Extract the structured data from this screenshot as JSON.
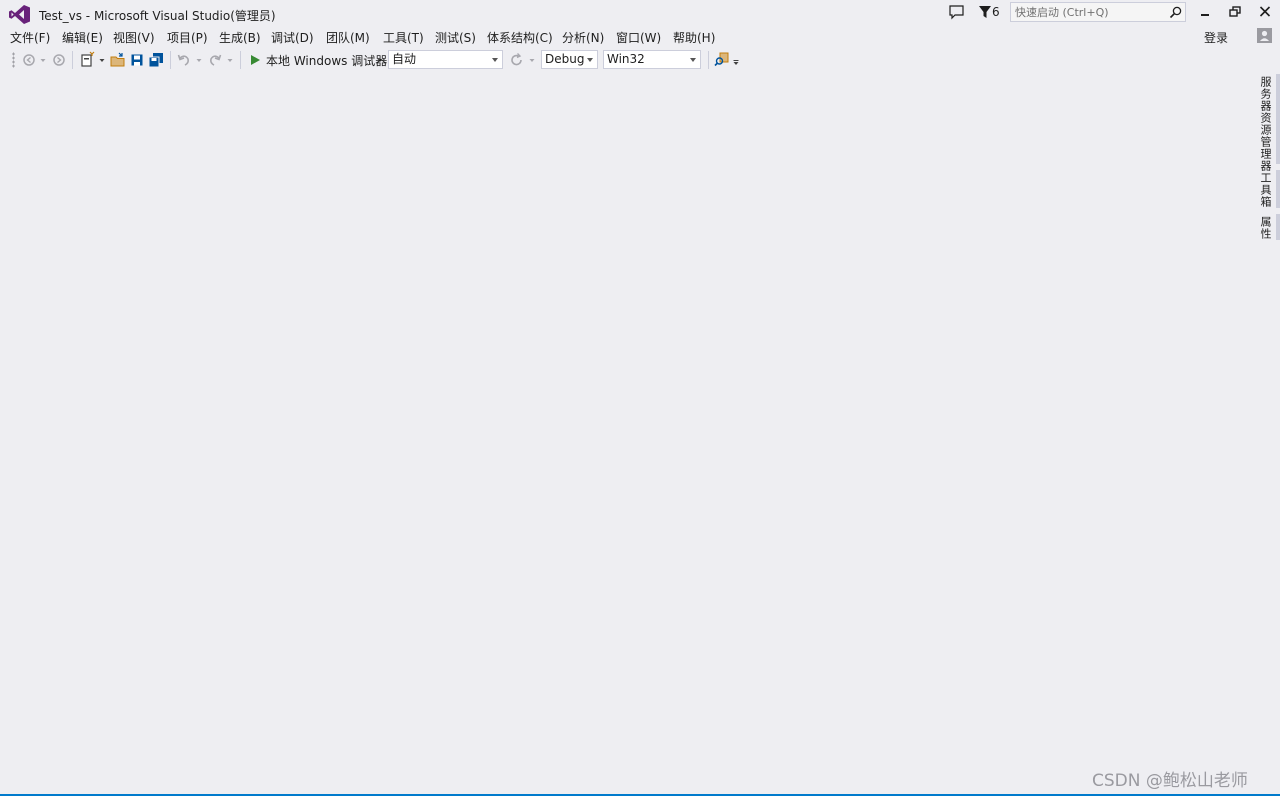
{
  "window": {
    "title": "Test_vs - Microsoft Visual Studio(管理员)",
    "notification_count": "6",
    "quick_launch_placeholder": "快速启动 (Ctrl+Q)"
  },
  "menu": [
    {
      "label": "文件(F)"
    },
    {
      "label": "编辑(E)"
    },
    {
      "label": "视图(V)"
    },
    {
      "label": "项目(P)"
    },
    {
      "label": "生成(B)"
    },
    {
      "label": "调试(D)"
    },
    {
      "label": "团队(M)"
    },
    {
      "label": "工具(T)"
    },
    {
      "label": "测试(S)"
    },
    {
      "label": "体系结构(C)"
    },
    {
      "label": "分析(N)"
    },
    {
      "label": "窗口(W)"
    },
    {
      "label": "帮助(H)"
    }
  ],
  "account": {
    "login_label": "登录"
  },
  "toolbar": {
    "run_label": "本地 Windows 调试器",
    "solution_config_combo": "自动",
    "config_combo": "Debug",
    "platform_combo": "Win32"
  },
  "side_tabs": [
    {
      "label": "服务器资源管理器"
    },
    {
      "label": "工具箱"
    },
    {
      "label": "属性"
    }
  ],
  "watermark": "CSDN @鲍松山老师",
  "colors": {
    "background": "#eeeef2",
    "vs_purple": "#68217a",
    "run_green": "#388a34",
    "accent_blue": "#007acc"
  }
}
